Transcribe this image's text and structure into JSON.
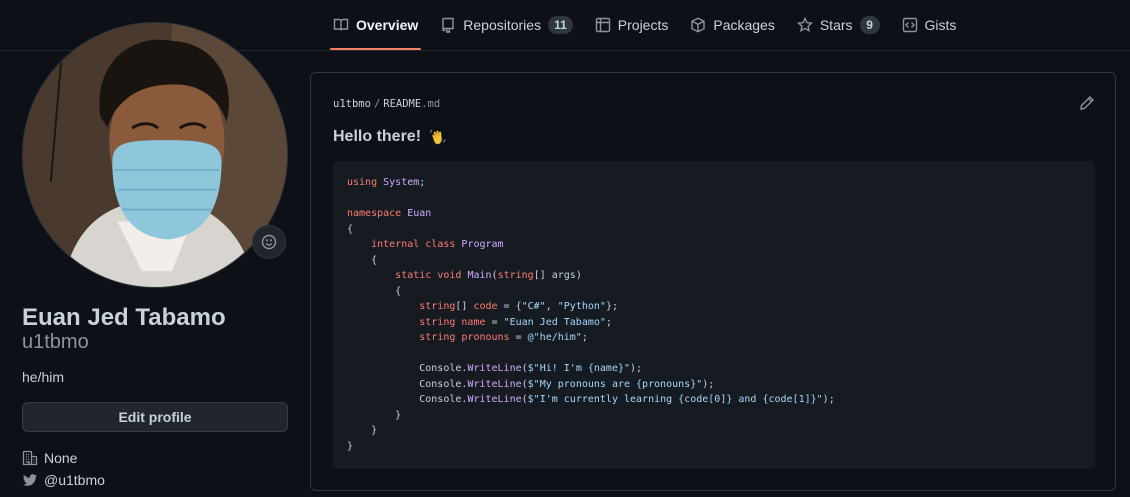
{
  "nav": {
    "tabs": [
      {
        "label": "Overview",
        "icon": "book-icon"
      },
      {
        "label": "Repositories",
        "icon": "repo-icon",
        "count": "11"
      },
      {
        "label": "Projects",
        "icon": "project-icon"
      },
      {
        "label": "Packages",
        "icon": "package-icon"
      },
      {
        "label": "Stars",
        "icon": "star-icon",
        "count": "9"
      },
      {
        "label": "Gists",
        "icon": "code-square-icon"
      }
    ],
    "active_tab": "Overview",
    "accent_color": "#f78166"
  },
  "profile": {
    "full_name": "Euan Jed Tabamo",
    "username": "u1tbmo",
    "bio": "he/him",
    "edit_label": "Edit profile",
    "company": "None",
    "twitter": "@u1tbmo"
  },
  "readme": {
    "owner": "u1tbmo",
    "filename": "README",
    "extension": ".md",
    "heading": "Hello there!",
    "code": {
      "l1a": "using",
      "l1b": "System",
      "l3a": "namespace",
      "l3b": "Euan",
      "l5a": "internal class",
      "l5b": "Program",
      "l7a": "static void",
      "l7b": "Main",
      "l7c": "string",
      "l7d": "args",
      "v1type": "string",
      "v1": "code",
      "v1s1": "\"C#\"",
      "v1s2": "\"Python\"",
      "v2type": "string",
      "v2": "name",
      "v2s": "\"Euan Jed Tabamo\"",
      "v3type": "string",
      "v3": "pronouns",
      "v3s": "@\"he/him\"",
      "console": "Console",
      "wl": "WriteLine",
      "p1s": "$\"Hi! I'm {name}\"",
      "p2s": "$\"My pronouns are {pronouns}\"",
      "p3s": "$\"I'm currently learning {code[0]} and {code[1]}\""
    }
  },
  "colors": {
    "background": "#0d1117",
    "code_bg": "#161b22",
    "keyword": "#ff7b72",
    "type": "#d2a8ff",
    "string": "#a5d6ff"
  }
}
